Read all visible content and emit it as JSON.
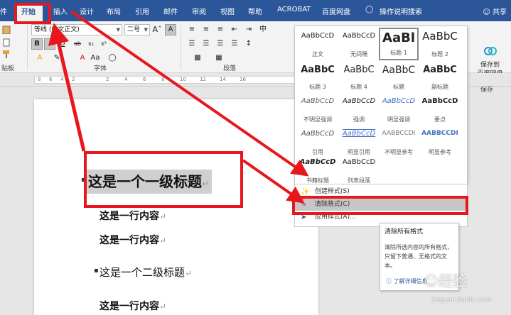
{
  "tabs": [
    "件",
    "开始",
    "插入",
    "设计",
    "布局",
    "引用",
    "邮件",
    "审阅",
    "视图",
    "帮助",
    "ACROBAT",
    "百度网盘"
  ],
  "tell_me": "操作说明搜索",
  "share": "共享",
  "ribbon": {
    "font_name": "等线 (中文正文)",
    "font_size": "二号",
    "group_clipboard": "贴板",
    "group_font": "字体",
    "group_paragraph": "段落",
    "group_save": "保存",
    "save_label_1": "保存到",
    "save_label_2": "百度网盘"
  },
  "ruler_ticks": [
    "8",
    "6",
    "4",
    "2",
    "2",
    "4",
    "6",
    "8",
    "10",
    "12",
    "14",
    "16"
  ],
  "styles": [
    {
      "preview": "AaBbCcD",
      "name": "正文"
    },
    {
      "preview": "AaBbCcD",
      "name": "无间隔"
    },
    {
      "preview": "AaBl",
      "name": "标题 1"
    },
    {
      "preview": "AaBbC",
      "name": "标题 2"
    },
    {
      "preview": "AaBbC",
      "name": "标题 3"
    },
    {
      "preview": "AaBbC",
      "name": "标题 4"
    },
    {
      "preview": "AaBbC",
      "name": "标题"
    },
    {
      "preview": "AaBbC",
      "name": "副标题"
    },
    {
      "preview": "AaBbCcD",
      "name": "不明显强调"
    },
    {
      "preview": "AaBbCcD",
      "name": "强调"
    },
    {
      "preview": "AaBbCcD",
      "name": "明显强调"
    },
    {
      "preview": "AaBbCcD",
      "name": "要点"
    },
    {
      "preview": "AaBbCcD",
      "name": "引用"
    },
    {
      "preview": "AaBbCcD",
      "name": "明显引用"
    },
    {
      "preview": "AABBCCDI",
      "name": "不明显参考"
    },
    {
      "preview": "AABBCCDI",
      "name": "明显参考"
    },
    {
      "preview": "AaBbCcD",
      "name": "书籍标题"
    },
    {
      "preview": "AaBbCcD",
      "name": "列表段落"
    }
  ],
  "menu": {
    "create": "创建样式(S)",
    "clear": "清除格式(C)",
    "apply": "应用样式(A)..."
  },
  "tooltip": {
    "title": "清除所有格式",
    "body": "清除所选内容的所有格式，只留下普通、无格式的文本。",
    "more": "了解详细信息"
  },
  "document": {
    "heading1": "这是一个一级标题",
    "line1": "这是一行内容",
    "line2": "这是一行内容",
    "heading2": "这是一个二级标题",
    "line3": "这是一行内容"
  },
  "watermark": "经验",
  "watermark_sub": "jingyan.baidu.com",
  "colors": {
    "accent": "#2b579a",
    "annotation": "#e8171d"
  }
}
